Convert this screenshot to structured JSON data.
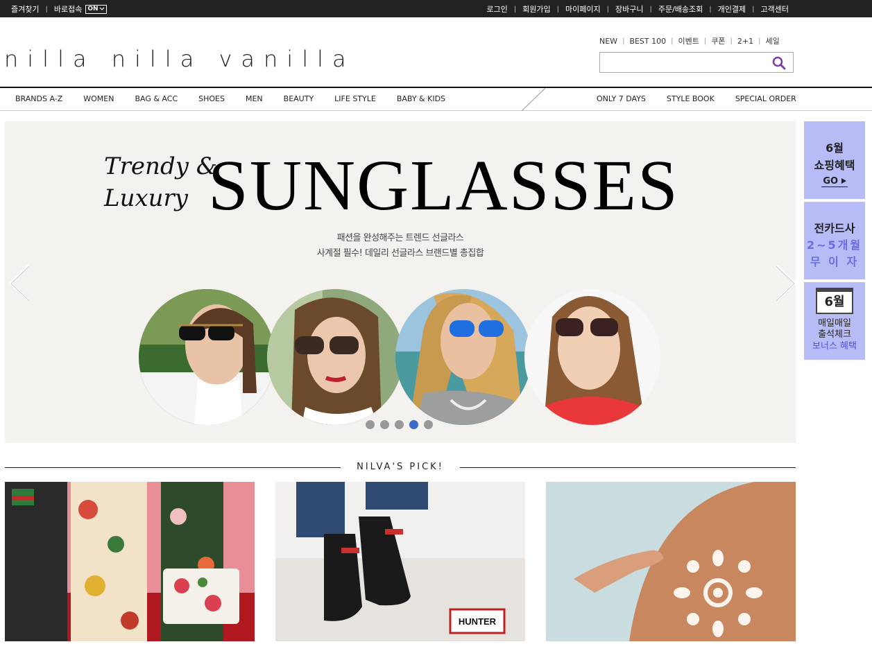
{
  "utility": {
    "favorites": "즐겨찾기",
    "shortcut": "바로접속",
    "shortcut_toggle": "ON",
    "links": [
      "로그인",
      "회원가입",
      "마이페이지",
      "장바구니",
      "주문/배송조회",
      "개인결제",
      "고객센터"
    ]
  },
  "header": {
    "logo": "nilla nilla vanilla",
    "quick_links": [
      "NEW",
      "BEST 100",
      "이벤트",
      "쿠폰",
      "2+1",
      "세일"
    ],
    "search": {
      "value": "",
      "placeholder": ""
    }
  },
  "nav": {
    "left": [
      "BRANDS A-Z",
      "WOMEN",
      "BAG & ACC",
      "SHOES",
      "MEN",
      "BEAUTY",
      "LIFE STYLE",
      "BABY & KIDS"
    ],
    "right": [
      "ONLY 7 DAYS",
      "STYLE BOOK",
      "SPECIAL ORDER"
    ]
  },
  "banner": {
    "line1": "Trendy &",
    "line2": "Luxury",
    "headline": "SUNGLASSES",
    "sub1": "패션을 완성해주는 트렌드 선글라스",
    "sub2": "사계절 필수! 데일리 선글라스 브랜드별 총집합",
    "slide_count": 5,
    "active_slide": 4
  },
  "side": {
    "promo1": {
      "line1": "6월",
      "line2": "쇼핑혜택",
      "go": "GO"
    },
    "promo2": {
      "line1": "전카드사",
      "line2": "2~5개월",
      "line3": "무 이 자"
    },
    "promo3": {
      "cal": "6월",
      "line1": "매일매일",
      "line2": "출석체크",
      "line3": "보너스 혜택"
    }
  },
  "pick": {
    "title": "NILVA'S PICK!",
    "brand_label": "HUNTER"
  },
  "colors": {
    "topbar": "#222222",
    "side_bg": "#b8bcf6",
    "accent_purple": "#6a6ce6",
    "active_dot": "#3a6bc7",
    "search_icon": "#7b3fa6"
  }
}
